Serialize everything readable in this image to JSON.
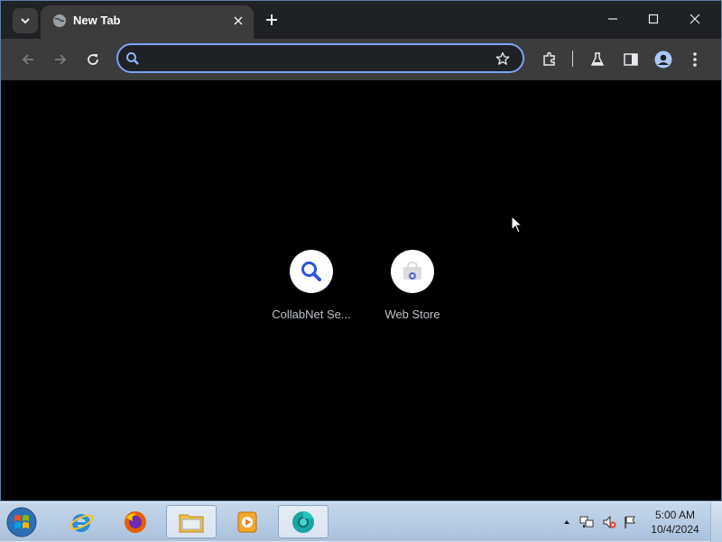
{
  "browser": {
    "tab": {
      "title": "New Tab"
    },
    "omnibox": {
      "value": "",
      "placeholder": ""
    },
    "shortcuts": [
      {
        "label": "CollabNet Se...",
        "icon": "search-icon"
      },
      {
        "label": "Web Store",
        "icon": "web-store-icon"
      }
    ],
    "colors": {
      "accent": "#7ba2f4",
      "tab_bg": "#3c3c3c",
      "page_bg": "#000000"
    }
  },
  "taskbar": {
    "time": "5:00 AM",
    "date": "10/4/2024",
    "apps": [
      "internet-explorer",
      "firefox",
      "file-explorer",
      "media-player",
      "chrome-canary"
    ]
  }
}
